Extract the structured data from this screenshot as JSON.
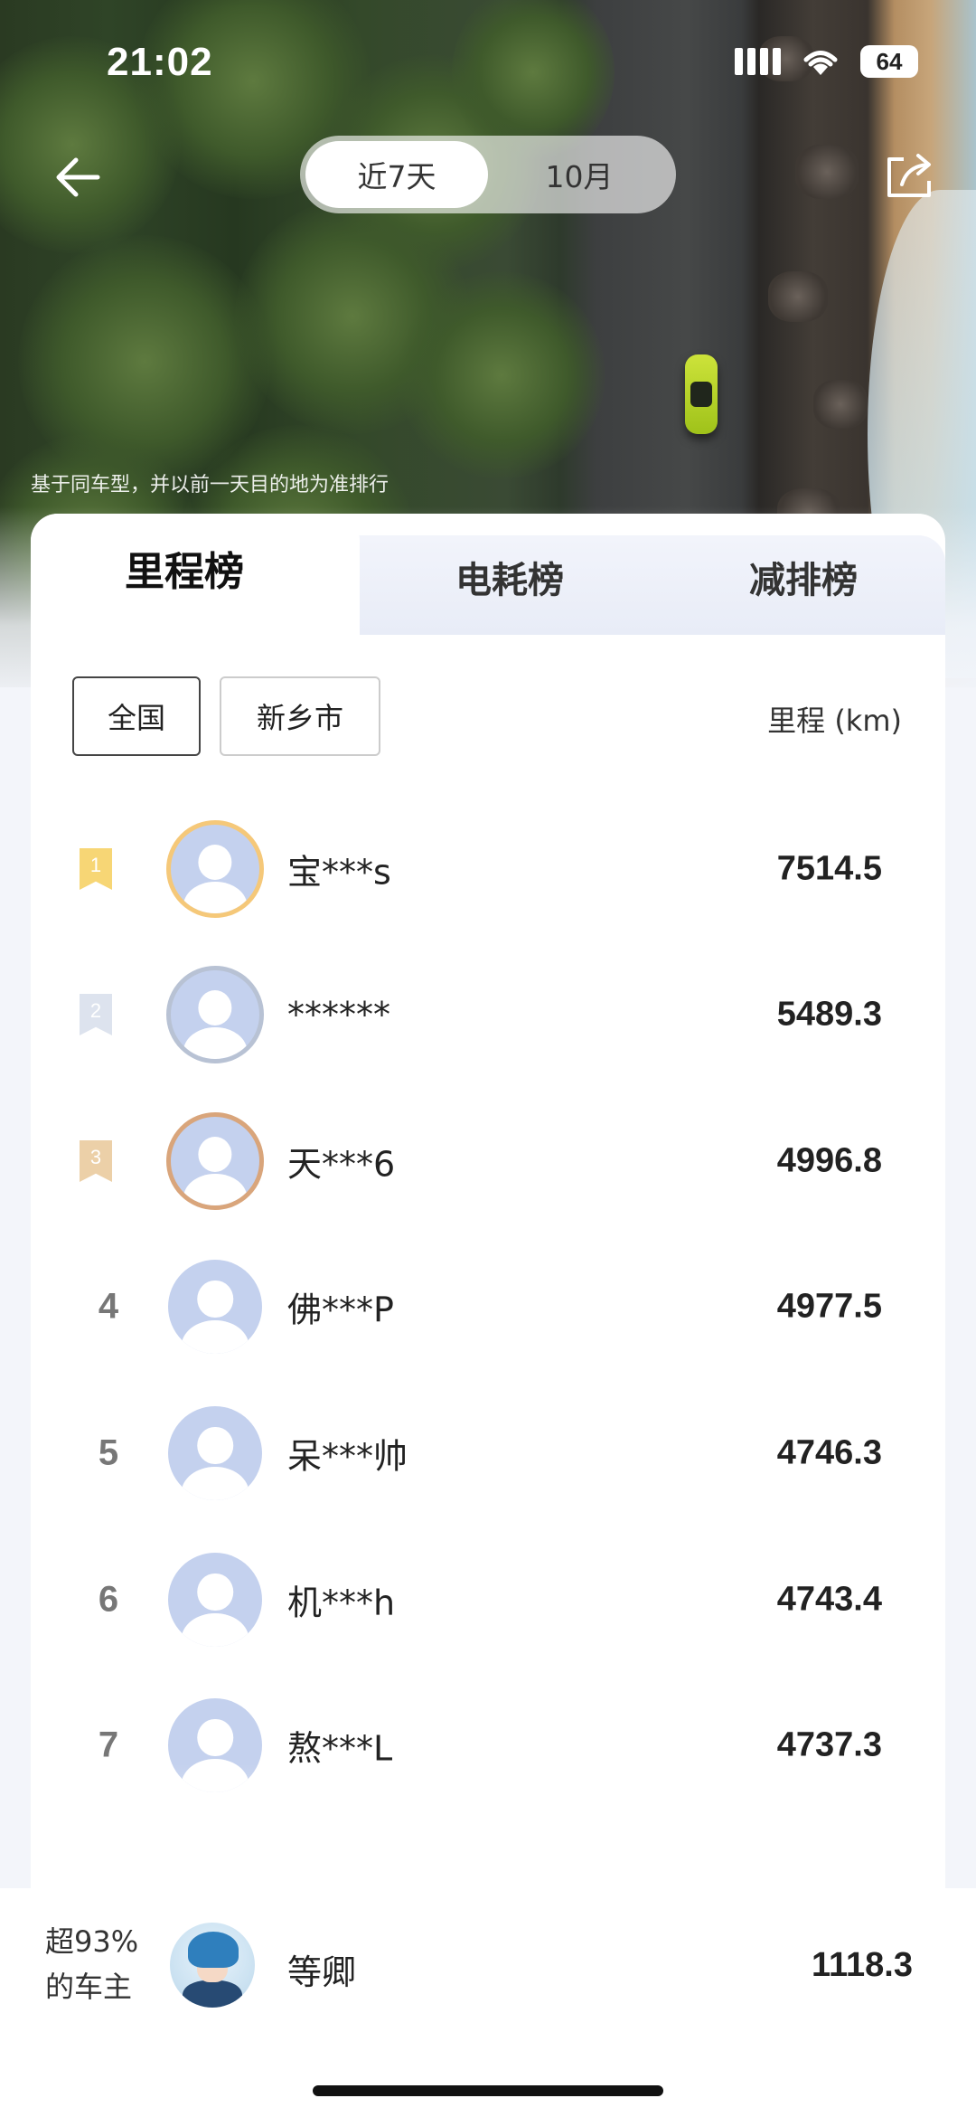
{
  "status_bar": {
    "time": "21:02",
    "battery": "64"
  },
  "header": {
    "period_tabs": [
      {
        "label": "近7天",
        "active": true
      },
      {
        "label": "10月",
        "active": false
      }
    ]
  },
  "note": "基于同车型，并以前一天目的地为准排行",
  "board_tabs": [
    {
      "label": "里程榜",
      "active": true
    },
    {
      "label": "电耗榜",
      "active": false
    },
    {
      "label": "减排榜",
      "active": false
    }
  ],
  "filters": {
    "national": "全国",
    "city": "新乡市"
  },
  "column_header": "里程 (km)",
  "rows": [
    {
      "rank": "1",
      "name": "宝***s",
      "value": "7514.5"
    },
    {
      "rank": "2",
      "name": "******",
      "value": "5489.3"
    },
    {
      "rank": "3",
      "name": "天***6",
      "value": "4996.8"
    },
    {
      "rank": "4",
      "name": "佛***P",
      "value": "4977.5"
    },
    {
      "rank": "5",
      "name": "呆***帅",
      "value": "4746.3"
    },
    {
      "rank": "6",
      "name": "机***h",
      "value": "4743.4"
    },
    {
      "rank": "7",
      "name": "熬***L",
      "value": "4737.3"
    }
  ],
  "self": {
    "percent_line1": "超93%",
    "percent_line2": "的车主",
    "name": "等卿",
    "value": "1118.3"
  },
  "colors": {
    "gold": "#f7d675",
    "silver": "#dde3ee",
    "bronze": "#ecd0a8",
    "avatar_bg": "#c4d1ee"
  }
}
